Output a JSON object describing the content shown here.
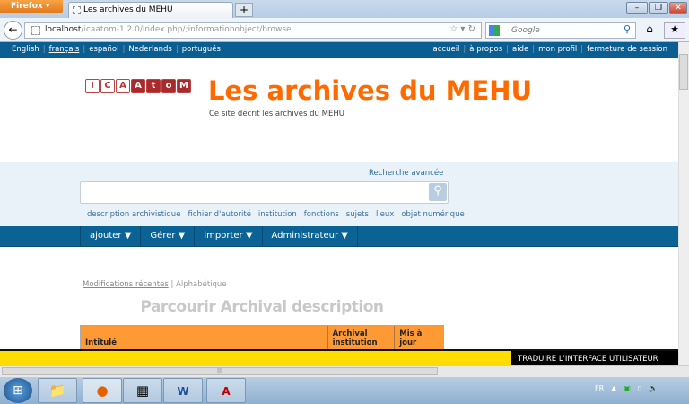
{
  "browser": {
    "menu_label": "Firefox",
    "tab_title": "Les archives du MEHU",
    "new_tab": "+",
    "url_host": "localhost",
    "url_path": "/icaatom-1.2.0/index.php/;informationobject/browse",
    "search_engine": "Google",
    "window_buttons": [
      "–",
      "❐",
      "✕"
    ]
  },
  "languages": [
    "English",
    "français",
    "español",
    "Nederlands",
    "português"
  ],
  "user_links": [
    "accueil",
    "à propos",
    "aide",
    "mon profil",
    "fermeture de session"
  ],
  "logo_letters": [
    "I",
    "C",
    "A",
    "A",
    "t",
    "o",
    "M"
  ],
  "site": {
    "title": "Les archives du MEHU",
    "description": "Ce site décrit les archives du MEHU"
  },
  "search": {
    "advanced": "Recherche avancée",
    "value": ""
  },
  "browse_links": [
    "description archivistique",
    "fichier d'autorité",
    "institution",
    "fonctions",
    "sujets",
    "lieux",
    "objet numérique"
  ],
  "menu": [
    "ajouter ▼",
    "Gérer ▼",
    "importer ▼",
    "Administrateur ▼"
  ],
  "sort": {
    "recent": "Modifications récentes",
    "sep": "|",
    "alpha": "Alphabétique"
  },
  "heading": "Parcourir Archival description",
  "table": {
    "headers": [
      "Intitulé",
      "Archival institution",
      "Mis à jour"
    ]
  },
  "translate_bar": "TRADUIRE L'INTERFACE UTILISATEUR",
  "taskbar": {
    "lang": "FR"
  },
  "colors": {
    "brand_orange": "#ff6a00",
    "nav_blue": "#0a6394",
    "table_header": "#ff9933",
    "yellow": "#ffdd00"
  }
}
